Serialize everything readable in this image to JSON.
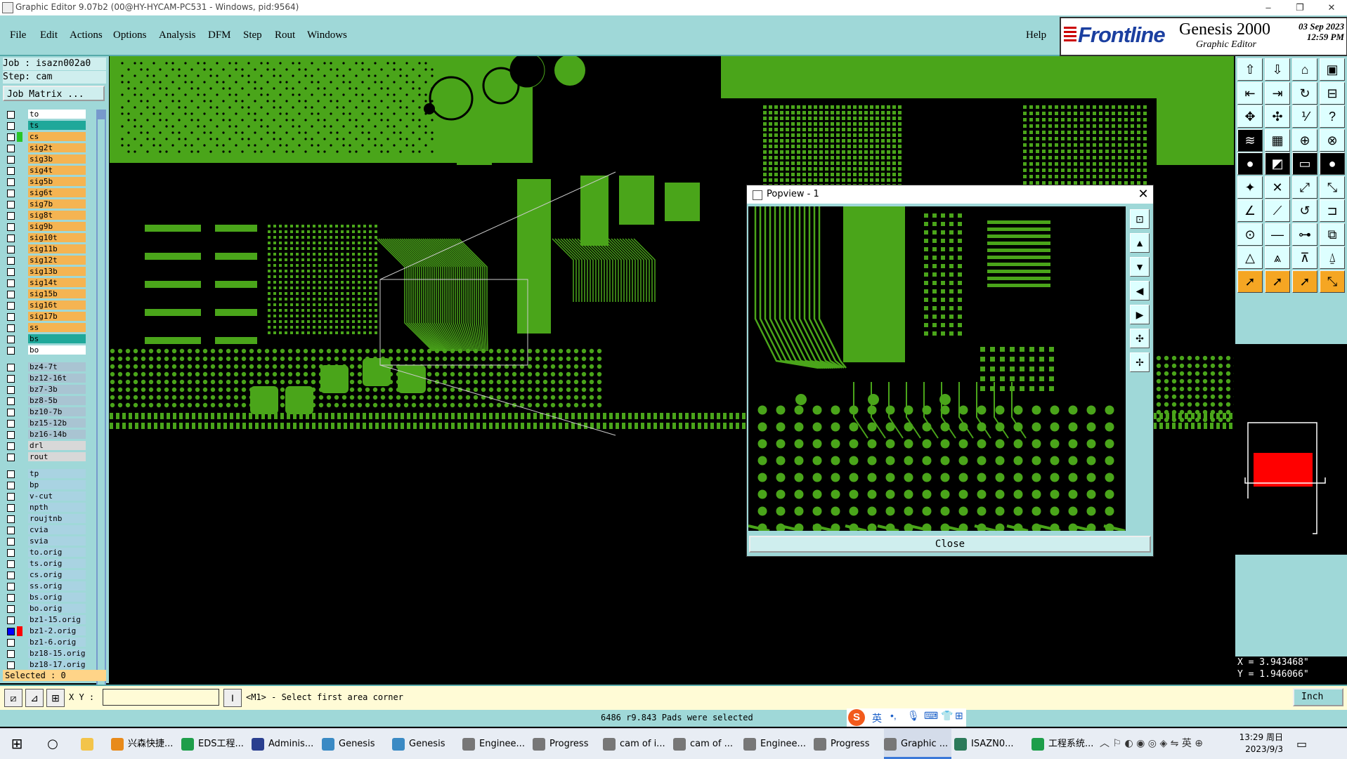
{
  "window": {
    "title": "Graphic Editor 9.07b2 (00@HY-HYCAM-PC531 - Windows, pid:9564)",
    "controls": [
      "–",
      "❐",
      "✕"
    ]
  },
  "menu": {
    "items": [
      "File",
      "Edit",
      "Actions",
      "Options",
      "Analysis",
      "DFM",
      "Step",
      "Rout",
      "Windows"
    ],
    "help": "Help"
  },
  "brand": {
    "logo": "Frontline",
    "product": "Genesis 2000",
    "subtitle": "Graphic Editor",
    "date": "03 Sep 2023",
    "time": "12:59 PM"
  },
  "job": {
    "job_label": "Job : isazn002a0",
    "step_label": "Step: cam",
    "matrix_button": "Job Matrix ..."
  },
  "layers": [
    {
      "name": "to",
      "color": "#ffffff",
      "bg": "#ffffff",
      "checked": false
    },
    {
      "name": "ts",
      "color": "#ffffff",
      "bg": "#1fa89a",
      "checked": false
    },
    {
      "name": "cs",
      "color": "#27c627",
      "bg": "#f5b452",
      "checked": false
    },
    {
      "name": "sig2t",
      "color": "#ffffff",
      "bg": "#f5b452",
      "checked": false
    },
    {
      "name": "sig3b",
      "color": "#ffffff",
      "bg": "#f5b452",
      "checked": false
    },
    {
      "name": "sig4t",
      "color": "#ffffff",
      "bg": "#f5b452",
      "checked": false
    },
    {
      "name": "sig5b",
      "color": "#ffffff",
      "bg": "#f5b452",
      "checked": false
    },
    {
      "name": "sig6t",
      "color": "#ffffff",
      "bg": "#f5b452",
      "checked": false
    },
    {
      "name": "sig7b",
      "color": "#ffffff",
      "bg": "#f5b452",
      "checked": false
    },
    {
      "name": "sig8t",
      "color": "#ffffff",
      "bg": "#f5b452",
      "checked": false
    },
    {
      "name": "sig9b",
      "color": "#ffffff",
      "bg": "#f5b452",
      "checked": false
    },
    {
      "name": "sig10t",
      "color": "#ffffff",
      "bg": "#f5b452",
      "checked": false
    },
    {
      "name": "sig11b",
      "color": "#ffffff",
      "bg": "#f5b452",
      "checked": false
    },
    {
      "name": "sig12t",
      "color": "#ffffff",
      "bg": "#f5b452",
      "checked": false
    },
    {
      "name": "sig13b",
      "color": "#ffffff",
      "bg": "#f5b452",
      "checked": false
    },
    {
      "name": "sig14t",
      "color": "#ffffff",
      "bg": "#f5b452",
      "checked": false
    },
    {
      "name": "sig15b",
      "color": "#ffffff",
      "bg": "#f5b452",
      "checked": false
    },
    {
      "name": "sig16t",
      "color": "#ffffff",
      "bg": "#f5b452",
      "checked": false
    },
    {
      "name": "sig17b",
      "color": "#ffffff",
      "bg": "#f5b452",
      "checked": false
    },
    {
      "name": "ss",
      "color": "#ffffff",
      "bg": "#f5b452",
      "checked": false
    },
    {
      "name": "bs",
      "color": "#ffffff",
      "bg": "#1fa89a",
      "checked": false
    },
    {
      "name": "bo",
      "color": "#ffffff",
      "bg": "#ffffff",
      "checked": false
    },
    {
      "name": "bz4-7t",
      "color": "#ffffff",
      "bg": "#a9c4d2",
      "checked": false
    },
    {
      "name": "bz12-16t",
      "color": "#ffffff",
      "bg": "#a9c4d2",
      "checked": false
    },
    {
      "name": "bz7-3b",
      "color": "#ffffff",
      "bg": "#a9c4d2",
      "checked": false
    },
    {
      "name": "bz8-5b",
      "color": "#ffffff",
      "bg": "#a9c4d2",
      "checked": false
    },
    {
      "name": "bz10-7b",
      "color": "#ffffff",
      "bg": "#a9c4d2",
      "checked": false
    },
    {
      "name": "bz15-12b",
      "color": "#ffffff",
      "bg": "#a9c4d2",
      "checked": false
    },
    {
      "name": "bz16-14b",
      "color": "#ffffff",
      "bg": "#a9c4d2",
      "checked": false
    },
    {
      "name": "drl",
      "color": "#ffffff",
      "bg": "#d8d8d8",
      "checked": false
    },
    {
      "name": "rout",
      "color": "#ffffff",
      "bg": "#d8d8d8",
      "checked": false
    },
    {
      "name": "tp",
      "color": "#ffffff",
      "bg": "#a9d3e2",
      "checked": false
    },
    {
      "name": "bp",
      "color": "#ffffff",
      "bg": "#a9d3e2",
      "checked": false
    },
    {
      "name": "v-cut",
      "color": "#ffffff",
      "bg": "#a9d3e2",
      "checked": false
    },
    {
      "name": "npth",
      "color": "#ffffff",
      "bg": "#a9d3e2",
      "checked": false
    },
    {
      "name": "roujtnb",
      "color": "#ffffff",
      "bg": "#a9d3e2",
      "checked": false
    },
    {
      "name": "cvia",
      "color": "#ffffff",
      "bg": "#a9d3e2",
      "checked": false
    },
    {
      "name": "svia",
      "color": "#ffffff",
      "bg": "#a9d3e2",
      "checked": false
    },
    {
      "name": "to.orig",
      "color": "#ffffff",
      "bg": "#a9d3e2",
      "checked": false
    },
    {
      "name": "ts.orig",
      "color": "#ffffff",
      "bg": "#a9d3e2",
      "checked": false
    },
    {
      "name": "cs.orig",
      "color": "#ffffff",
      "bg": "#a9d3e2",
      "checked": false
    },
    {
      "name": "ss.orig",
      "color": "#ffffff",
      "bg": "#a9d3e2",
      "checked": false
    },
    {
      "name": "bs.orig",
      "color": "#ffffff",
      "bg": "#a9d3e2",
      "checked": false
    },
    {
      "name": "bo.orig",
      "color": "#ffffff",
      "bg": "#a9d3e2",
      "checked": false
    },
    {
      "name": "bz1-15.orig",
      "color": "#ffffff",
      "bg": "#a9d3e2",
      "checked": false
    },
    {
      "name": "bz1-2.orig",
      "color": "#ff0000",
      "bg": "#a9d3e2",
      "checked": true
    },
    {
      "name": "bz1-6.orig",
      "color": "#ffffff",
      "bg": "#a9d3e2",
      "checked": false
    },
    {
      "name": "bz18-15.orig",
      "color": "#ffffff",
      "bg": "#a9d3e2",
      "checked": false
    },
    {
      "name": "bz18-17.orig",
      "color": "#ffffff",
      "bg": "#a9d3e2",
      "checked": false
    }
  ],
  "selected_label": "Selected : 0",
  "popview": {
    "title": "Popview - 1",
    "close_button": "Close"
  },
  "coords": {
    "x": "X = 3.943468\"",
    "y": "Y = 1.946066\""
  },
  "command": {
    "xy_label": "X Y :",
    "xy_value": "",
    "prompt": "<M1> - Select first area corner",
    "units": "Inch"
  },
  "status": "6486 r9.843 Pads were selected",
  "ime": {
    "lang": "英"
  },
  "taskbar": {
    "items": [
      {
        "label": "兴森快捷...",
        "color": "#e88a1a"
      },
      {
        "label": "EDS工程...",
        "color": "#1e9e4a"
      },
      {
        "label": "Adminis...",
        "color": "#2a3f8f"
      },
      {
        "label": "Genesis",
        "color": "#3a8ac4"
      },
      {
        "label": "Genesis",
        "color": "#3a8ac4"
      },
      {
        "label": "Enginee...",
        "color": "#777777"
      },
      {
        "label": "Progress",
        "color": "#777777"
      },
      {
        "label": "cam of i...",
        "color": "#777777"
      },
      {
        "label": "cam of ...",
        "color": "#777777"
      },
      {
        "label": "Enginee...",
        "color": "#777777"
      },
      {
        "label": "Progress",
        "color": "#777777"
      },
      {
        "label": "Graphic ...",
        "color": "#777777"
      },
      {
        "label": "ISAZN0...",
        "color": "#2c7a5a"
      },
      {
        "label": "工程系统...",
        "color": "#1e9e4a"
      }
    ],
    "tray_lang": "英",
    "time": "13:29 周日",
    "date": "2023/9/3"
  },
  "colors": {
    "accent": "#9fd8d8",
    "trace": "#4aa51a",
    "highlight": "#ff0000"
  }
}
